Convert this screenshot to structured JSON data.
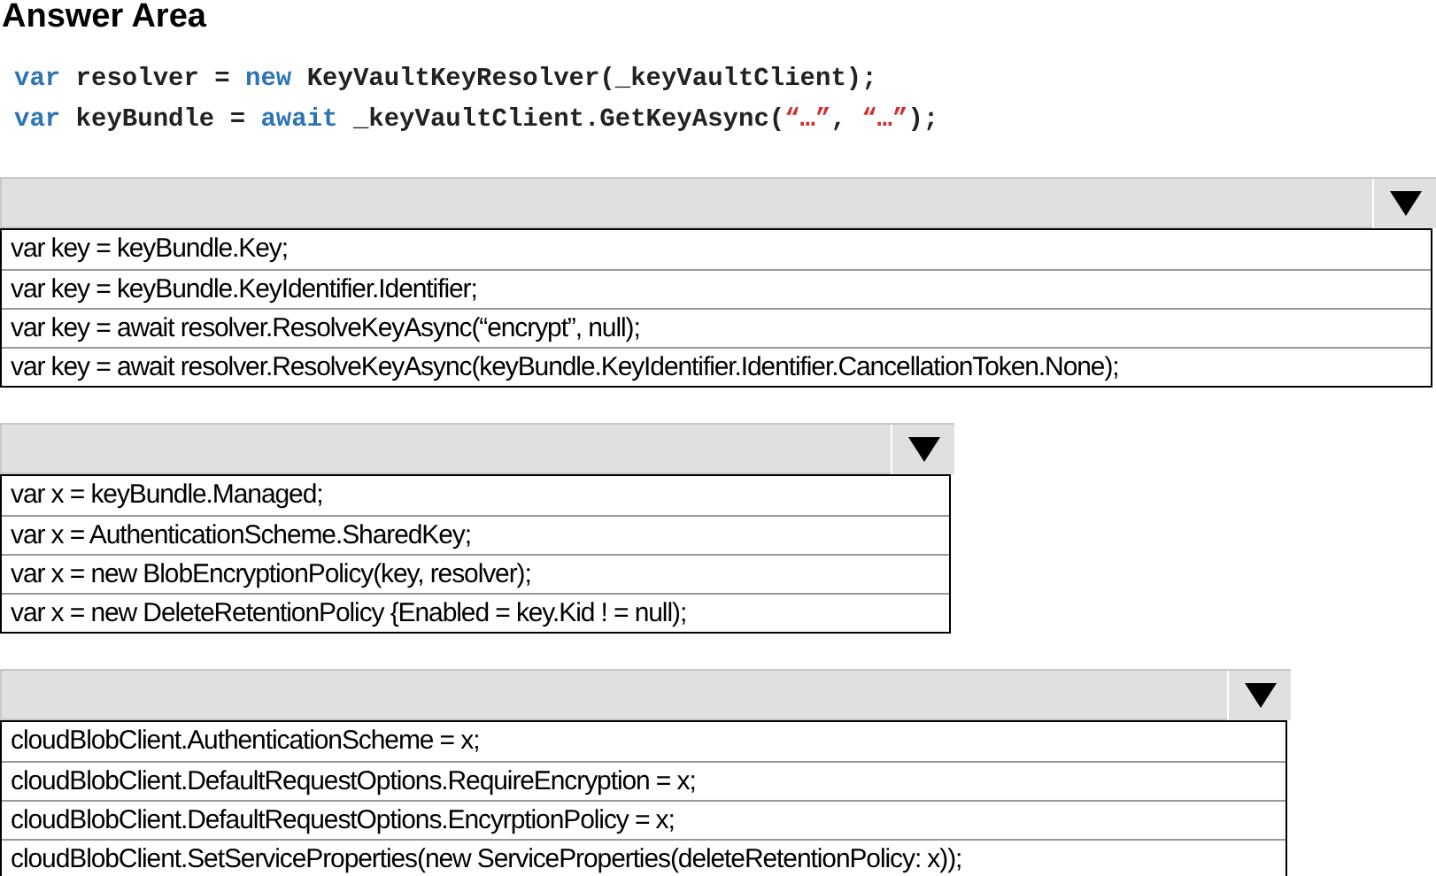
{
  "title": "Answer Area",
  "code_lines": [
    {
      "tokens": [
        {
          "kind": "keyword",
          "text": "var"
        },
        {
          "kind": "plain",
          "text": " resolver = "
        },
        {
          "kind": "keyword",
          "text": "new"
        },
        {
          "kind": "plain",
          "text": " KeyVaultKeyResolver(_keyVaultClient);"
        }
      ]
    },
    {
      "tokens": [
        {
          "kind": "keyword",
          "text": "var"
        },
        {
          "kind": "plain",
          "text": " keyBundle = "
        },
        {
          "kind": "keyword",
          "text": "await"
        },
        {
          "kind": "plain",
          "text": " _keyVaultClient.GetKeyAsync("
        },
        {
          "kind": "string",
          "text": "“…”"
        },
        {
          "kind": "plain",
          "text": ", "
        },
        {
          "kind": "string",
          "text": "“…”"
        },
        {
          "kind": "plain",
          "text": ");"
        }
      ]
    }
  ],
  "dropdowns": [
    {
      "options": [
        "var key = keyBundle.Key;",
        "var key = keyBundle.KeyIdentifier.Identifier;",
        "var key = await resolver.ResolveKeyAsync(“encrypt”, null);",
        "var key = await resolver.ResolveKeyAsync(keyBundle.KeyIdentifier.Identifier.CancellationToken.None);"
      ]
    },
    {
      "options": [
        "var x = keyBundle.Managed;",
        "var x = AuthenticationScheme.SharedKey;",
        "var x = new BlobEncryptionPolicy(key, resolver);",
        "var x = new DeleteRetentionPolicy {Enabled = key.Kid ! = null);"
      ]
    },
    {
      "options": [
        "cloudBlobClient.AuthenticationScheme = x;",
        "cloudBlobClient.DefaultRequestOptions.RequireEncryption = x;",
        "cloudBlobClient.DefaultRequestOptions.EncyrptionPolicy = x;",
        "cloudBlobClient.SetServiceProperties(new ServiceProperties(deleteRetentionPolicy: x));"
      ]
    }
  ]
}
